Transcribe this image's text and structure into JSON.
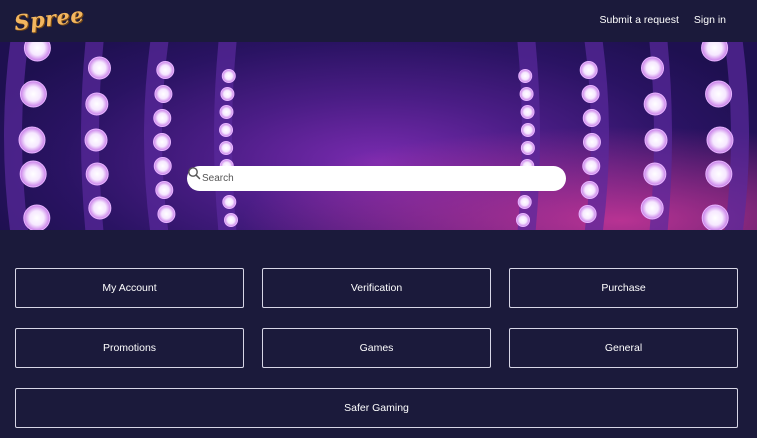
{
  "header": {
    "logo_text": "Spree",
    "nav": [
      "Submit a request",
      "Sign in"
    ]
  },
  "search": {
    "placeholder": "Search"
  },
  "categories": [
    "My Account",
    "Verification",
    "Purchase",
    "Promotions",
    "Games",
    "General",
    "Safer Gaming"
  ],
  "colors": {
    "background": "#1b1a3b",
    "logo": "#f3b65f",
    "hero_purple": "#4b1d86",
    "hero_pink": "#c02f9a",
    "bulb": "#f4e6ff"
  },
  "icons": [
    "search-icon"
  ]
}
